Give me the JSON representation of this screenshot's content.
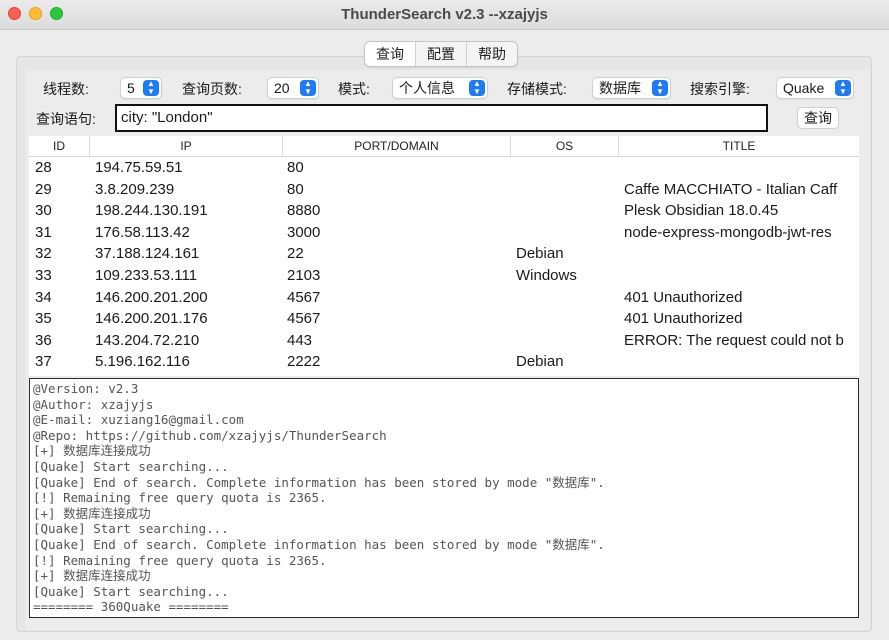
{
  "window": {
    "title": "ThunderSearch v2.3  --xzajyjs"
  },
  "tabs": [
    {
      "label": "查询",
      "active": true
    },
    {
      "label": "配置",
      "active": false
    },
    {
      "label": "帮助",
      "active": false
    }
  ],
  "toolbar": {
    "threads_label": "线程数:",
    "threads_value": "5",
    "pages_label": "查询页数:",
    "pages_value": "20",
    "mode_label": "模式:",
    "mode_value": "个人信息",
    "storage_label": "存储模式:",
    "storage_value": "数据库",
    "engine_label": "搜索引擎:",
    "engine_value": "Quake"
  },
  "query": {
    "label": "查询语句:",
    "value": "city: \"London\"",
    "button_label": "查询"
  },
  "table": {
    "columns": [
      "ID",
      "IP",
      "PORT/DOMAIN",
      "OS",
      "TITLE"
    ],
    "rows": [
      {
        "id": "28",
        "ip": "194.75.59.51",
        "port": "80",
        "os": "",
        "title": ""
      },
      {
        "id": "29",
        "ip": "3.8.209.239",
        "port": "80",
        "os": "",
        "title": "Caffe MACCHIATO - Italian Caff"
      },
      {
        "id": "30",
        "ip": "198.244.130.191",
        "port": "8880",
        "os": "",
        "title": "Plesk Obsidian 18.0.45"
      },
      {
        "id": "31",
        "ip": "176.58.113.42",
        "port": "3000",
        "os": "",
        "title": "node-express-mongodb-jwt-res"
      },
      {
        "id": "32",
        "ip": "37.188.124.161",
        "port": "22",
        "os": "Debian",
        "title": ""
      },
      {
        "id": "33",
        "ip": "109.233.53.111",
        "port": "2103",
        "os": "Windows",
        "title": ""
      },
      {
        "id": "34",
        "ip": "146.200.201.200",
        "port": "4567",
        "os": "",
        "title": "401 Unauthorized"
      },
      {
        "id": "35",
        "ip": "146.200.201.176",
        "port": "4567",
        "os": "",
        "title": "401 Unauthorized"
      },
      {
        "id": "36",
        "ip": "143.204.72.210",
        "port": "443",
        "os": "",
        "title": "ERROR: The request could not b"
      },
      {
        "id": "37",
        "ip": "5.196.162.116",
        "port": "2222",
        "os": "Debian",
        "title": ""
      }
    ]
  },
  "log": [
    "@Version: v2.3",
    "@Author: xzajyjs",
    "@E-mail: xuziang16@gmail.com",
    "@Repo: https://github.com/xzajyjs/ThunderSearch",
    "[+] 数据库连接成功",
    "[Quake] Start searching...",
    "[Quake] End of search. Complete information has been stored by mode \"数据库\".",
    "[!] Remaining free query quota is 2365.",
    "[+] 数据库连接成功",
    "[Quake] Start searching...",
    "[Quake] End of search. Complete information has been stored by mode \"数据库\".",
    "[!] Remaining free query quota is 2365.",
    "[+] 数据库连接成功",
    "[Quake] Start searching...",
    "======== 360Quake ========"
  ],
  "colors": {
    "accent": "#1e7bf6",
    "close": "#fe5f57",
    "minimize": "#febc2e",
    "zoom": "#28c840"
  }
}
